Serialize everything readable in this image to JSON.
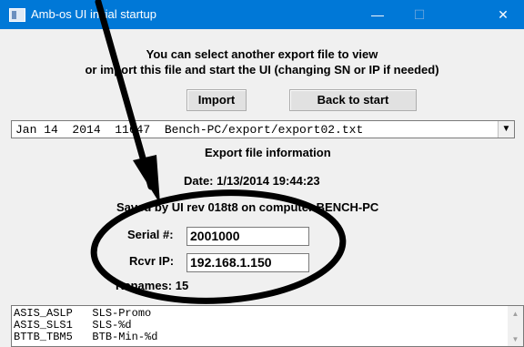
{
  "window": {
    "title": "Amb-os UI initial startup",
    "minimize_glyph": "—",
    "maximize_glyph": "☐",
    "close_glyph": "✕"
  },
  "intro": {
    "line1": "You can select another export file to view",
    "line2": "or import this file and start the UI (changing SN or IP if needed)"
  },
  "buttons": {
    "import_label": "Import",
    "back_label": "Back to start"
  },
  "export_select": {
    "value": "Jan 14  2014  11647  Bench-PC/export/export02.txt",
    "arrow_glyph": "▼"
  },
  "info": {
    "heading": "Export file information",
    "date": "Date: 1/13/2014 19:44:23",
    "saved_by": "Saved by UI rev 018t8 on computer BENCH-PC",
    "renames": "Renames: 15"
  },
  "serial": {
    "label": "Serial #:",
    "value": "2001000"
  },
  "rcvr_ip": {
    "label": "Rcvr IP:",
    "value": "192.168.1.150"
  },
  "renames_list": [
    {
      "code": "ASIS_ASLP",
      "name": "SLS-Promo"
    },
    {
      "code": "ASIS_SLS1",
      "name": "SLS-%d"
    },
    {
      "code": "BTTB_TBM5",
      "name": "BTB-Min-%d"
    }
  ],
  "scroll": {
    "up_glyph": "▲",
    "down_glyph": "▼"
  },
  "annotation": {
    "color": "#000000"
  }
}
